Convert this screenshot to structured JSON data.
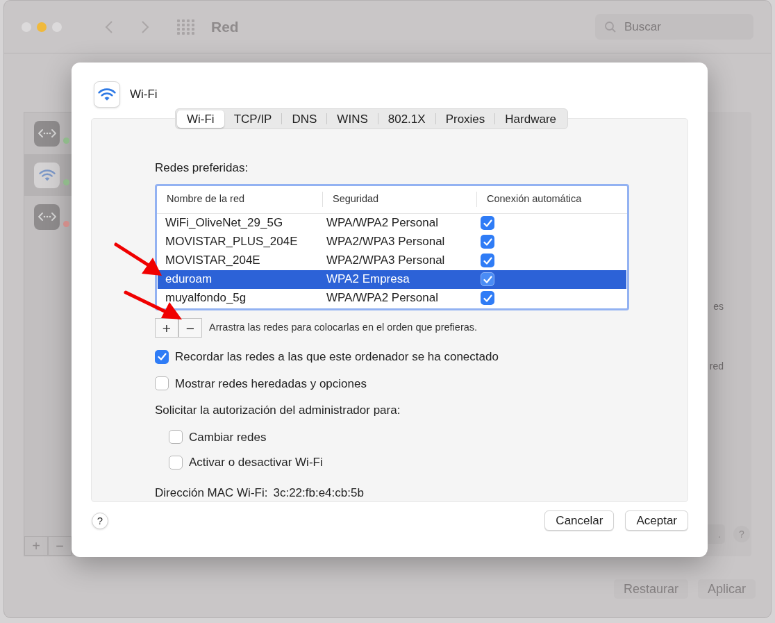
{
  "background_window": {
    "title": "Red",
    "search": {
      "placeholder": "Buscar"
    },
    "sidebar": {
      "items": [
        {
          "kind": "ethernet",
          "color": "#8fb98a",
          "selected": false
        },
        {
          "kind": "wifi",
          "color": "#8fb98a",
          "selected": true
        },
        {
          "kind": "ethernet",
          "color": "#d08d8a",
          "selected": false
        }
      ],
      "buttons": [
        "+",
        "−"
      ]
    },
    "panel_fragments": [
      "es",
      "red"
    ],
    "panel_button": ".",
    "help": "?",
    "buttons": [
      "Restaurar",
      "Aplicar"
    ]
  },
  "sheet": {
    "title": "Wi-Fi",
    "tabs": [
      {
        "label": "Wi-Fi",
        "selected": true
      },
      {
        "label": "TCP/IP",
        "selected": false
      },
      {
        "label": "DNS",
        "selected": false
      },
      {
        "label": "WINS",
        "selected": false
      },
      {
        "label": "802.1X",
        "selected": false
      },
      {
        "label": "Proxies",
        "selected": false
      },
      {
        "label": "Hardware",
        "selected": false
      }
    ],
    "networks_label": "Redes preferidas:",
    "table": {
      "columns": [
        "Nombre de la red",
        "Seguridad",
        "Conexión automática"
      ],
      "rows": [
        {
          "name": "WiFi_OliveNet_29_5G",
          "security": "WPA/WPA2 Personal",
          "auto_connect": true,
          "selected": false
        },
        {
          "name": "MOVISTAR_PLUS_204E",
          "security": "WPA2/WPA3 Personal",
          "auto_connect": true,
          "selected": false
        },
        {
          "name": "MOVISTAR_204E",
          "security": "WPA2/WPA3 Personal",
          "auto_connect": true,
          "selected": false
        },
        {
          "name": "eduroam",
          "security": "WPA2 Empresa",
          "auto_connect": true,
          "selected": true
        },
        {
          "name": "muyalfondo_5g",
          "security": "WPA/WPA2 Personal",
          "auto_connect": true,
          "selected": false
        }
      ]
    },
    "list_buttons": [
      "+",
      "−"
    ],
    "list_hint": "Arrastra las redes para colocarlas en el orden que prefieras.",
    "options": [
      {
        "label": "Recordar las redes a las que este ordenador se ha conectado",
        "checked": true
      },
      {
        "label": "Mostrar redes heredadas y opciones",
        "checked": false
      }
    ],
    "admin_label": "Solicitar la autorización del administrador para:",
    "admin_options": [
      {
        "label": "Cambiar redes",
        "checked": false
      },
      {
        "label": "Activar o desactivar Wi-Fi",
        "checked": false
      }
    ],
    "mac_label": "Dirección MAC Wi-Fi:",
    "mac_value": "3c:22:fb:e4:cb:5b",
    "help": "?",
    "buttons": [
      "Cancelar",
      "Aceptar"
    ]
  }
}
